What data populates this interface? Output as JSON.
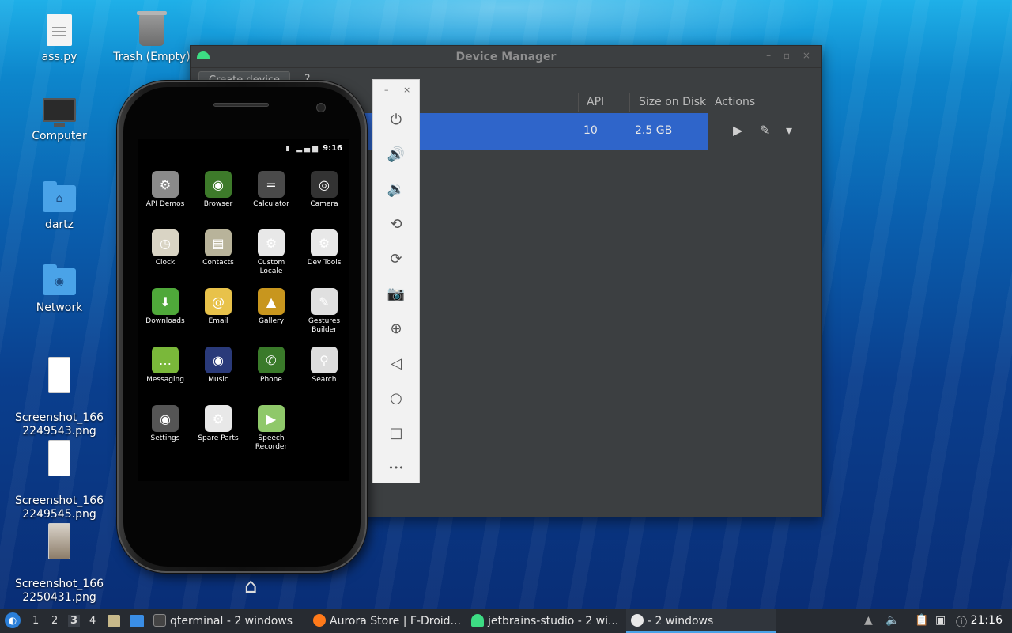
{
  "desktop": {
    "icons": [
      {
        "label": "ass.py"
      },
      {
        "label": "Trash (Empty)"
      },
      {
        "label": "Computer"
      },
      {
        "label": "dartz"
      },
      {
        "label": "Network"
      },
      {
        "label": "Screenshot_166\n2249543.png"
      },
      {
        "label": "Screenshot_166\n2249545.png"
      },
      {
        "label": "Screenshot_166\n2250431.png"
      }
    ]
  },
  "device_manager": {
    "title": "Device Manager",
    "create_device": "Create device",
    "help": "?",
    "columns": {
      "api": "API",
      "size": "Size on Disk",
      "actions": "Actions"
    },
    "row": {
      "api": "10",
      "size": "2.5 GB"
    },
    "actions": {
      "run": "▶",
      "edit": "✎",
      "more": "▾"
    }
  },
  "phone": {
    "time": "9:16",
    "apps": [
      {
        "label": "API Demos",
        "color": "#8a8a8a",
        "glyph": "⚙"
      },
      {
        "label": "Browser",
        "color": "#3d7a2a",
        "glyph": "◉"
      },
      {
        "label": "Calculator",
        "color": "#4a4a4a",
        "glyph": "="
      },
      {
        "label": "Camera",
        "color": "#333333",
        "glyph": "◎"
      },
      {
        "label": "Clock",
        "color": "#d9d4c4",
        "glyph": "◷"
      },
      {
        "label": "Contacts",
        "color": "#b8b39a",
        "glyph": "▤"
      },
      {
        "label": "Custom Locale",
        "color": "#e8e8e8",
        "glyph": "⚙"
      },
      {
        "label": "Dev Tools",
        "color": "#e8e8e8",
        "glyph": "⚙"
      },
      {
        "label": "Downloads",
        "color": "#4fa83a",
        "glyph": "⬇"
      },
      {
        "label": "Email",
        "color": "#e8c24a",
        "glyph": "@"
      },
      {
        "label": "Gallery",
        "color": "#c8961e",
        "glyph": "▲"
      },
      {
        "label": "Gestures Builder",
        "color": "#e0e0e0",
        "glyph": "✎"
      },
      {
        "label": "Messaging",
        "color": "#7ab83a",
        "glyph": "…"
      },
      {
        "label": "Music",
        "color": "#2a3a7a",
        "glyph": "◉"
      },
      {
        "label": "Phone",
        "color": "#3a7a2a",
        "glyph": "✆"
      },
      {
        "label": "Search",
        "color": "#dddddd",
        "glyph": "⚲"
      },
      {
        "label": "Settings",
        "color": "#555555",
        "glyph": "◉"
      },
      {
        "label": "Spare Parts",
        "color": "#e8e8e8",
        "glyph": "⚙"
      },
      {
        "label": "Speech Recorder",
        "color": "#8fc86a",
        "glyph": "▶"
      }
    ],
    "home_glyph": "⌂"
  },
  "emulator_toolbar": {
    "minimize": "–",
    "close": "×",
    "buttons": [
      {
        "name": "power-icon",
        "glyph": "⏻"
      },
      {
        "name": "volume-up-icon",
        "glyph": "🔊"
      },
      {
        "name": "volume-down-icon",
        "glyph": "🔉"
      },
      {
        "name": "rotate-left-icon",
        "glyph": "⟲"
      },
      {
        "name": "rotate-right-icon",
        "glyph": "⟳"
      },
      {
        "name": "camera-icon",
        "glyph": "📷"
      },
      {
        "name": "zoom-icon",
        "glyph": "⊕"
      },
      {
        "name": "back-icon",
        "glyph": "◁"
      },
      {
        "name": "home-icon",
        "glyph": "○"
      },
      {
        "name": "overview-icon",
        "glyph": "□"
      },
      {
        "name": "more-icon",
        "glyph": "•••"
      }
    ]
  },
  "taskbar": {
    "workspaces": [
      "1",
      "2",
      "3",
      "4"
    ],
    "active_workspace": "3",
    "tasks": [
      {
        "label": "qterminal - 2 windows"
      },
      {
        "label": "Aurora Store | F-Droid..."
      },
      {
        "label": "jetbrains-studio - 2 wi..."
      },
      {
        "label": "- 2 windows"
      }
    ],
    "clock": "21:16"
  }
}
